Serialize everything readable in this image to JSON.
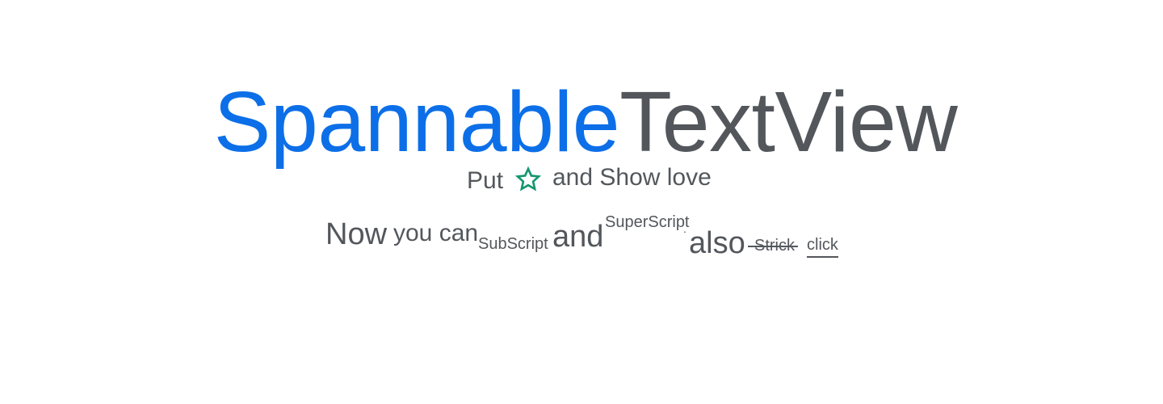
{
  "title": {
    "highlight": "Spannable",
    "rest": "TextView"
  },
  "love_line": {
    "prefix": "Put",
    "icon": "star-outline-icon",
    "icon_color": "#14976f",
    "suffix": "and Show love"
  },
  "styles_line": {
    "now": "Now",
    "you_can": "you can",
    "subscript": "SubScript",
    "and": "and",
    "superscript": "SuperScript",
    "dot": ".",
    "also": "also",
    "strike": "Strick",
    "click": "click"
  },
  "colors": {
    "accent_blue": "#0c6fe8",
    "text_gray": "#53575c",
    "star_green": "#14976f"
  }
}
